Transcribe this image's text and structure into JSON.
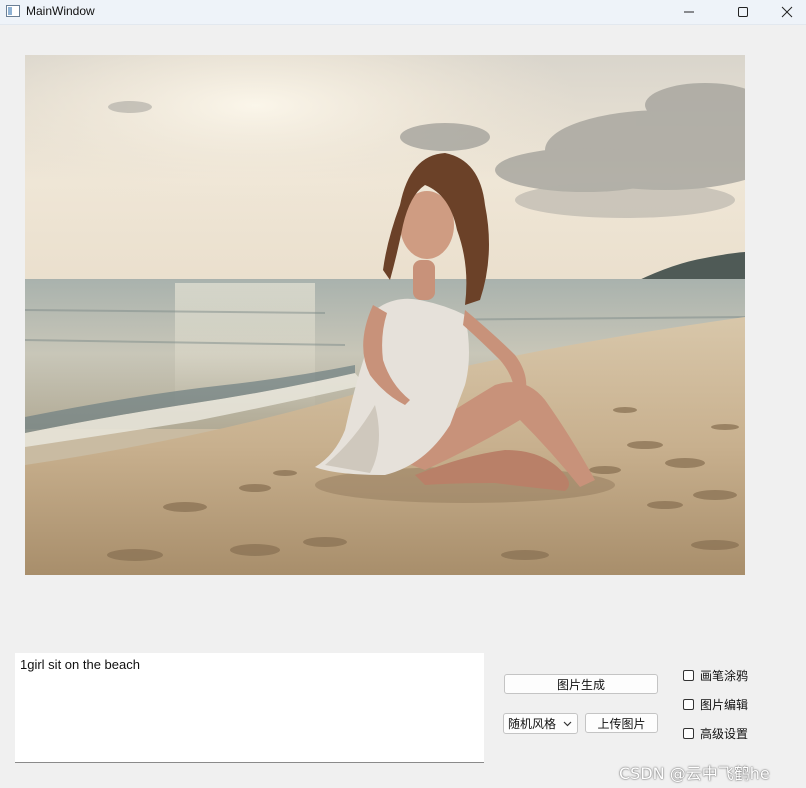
{
  "window": {
    "title": "MainWindow",
    "controls": [
      "minimize-icon",
      "maximize-icon",
      "close-icon"
    ]
  },
  "image": {
    "subject": "beach-photo"
  },
  "prompt": {
    "value": "1girl sit on the beach"
  },
  "controls": {
    "generate_label": "图片生成",
    "style_selected": "随机风格",
    "upload_label": "上传图片"
  },
  "options": [
    {
      "label": "画笔涂鸦",
      "checked": false
    },
    {
      "label": "图片编辑",
      "checked": false
    },
    {
      "label": "高级设置",
      "checked": false
    }
  ],
  "watermark": "CSDN @云中飞鹤he"
}
